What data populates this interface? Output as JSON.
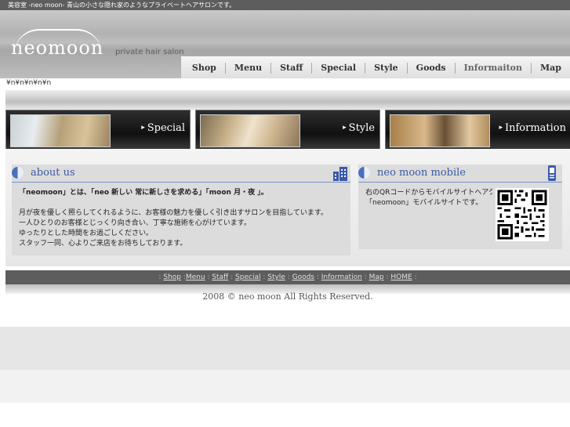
{
  "topbar": {
    "text": "美容室 -neo moon- 青山の小さな隠れ家のようなプライベートヘアサロンです。"
  },
  "header": {
    "logo": "neomoon",
    "tagline": "private hair salon",
    "nav": [
      "Shop",
      "Menu",
      "Staff",
      "Special",
      "Style",
      "Goods",
      "Informaiton",
      "Map"
    ]
  },
  "crumb": "¥n¥n¥n¥n¥n",
  "banners": [
    {
      "label": "Special"
    },
    {
      "label": "Style"
    },
    {
      "label": "Information"
    }
  ],
  "about": {
    "title": "about us",
    "lines": [
      "「neomoon」とは、「neo 新しい 常に新しさを求める」「moon 月・夜 」。",
      "月が夜を優しく照らしてくれるように、お客様の魅力を優しく引き出すサロンを目指しています。",
      "一人ひとりのお客様とじっくり向き合い、丁寧な施術を心がけています。",
      "ゆったりとした時間をお過ごしください。",
      "スタッフ一同、心よりご来店をお待ちしております。"
    ]
  },
  "mobile": {
    "title": "neo moon mobile",
    "lines": [
      "右のQRコードからモバイルサイトへアクセスできます。",
      "「neomoon」モバイルサイトです。"
    ]
  },
  "footer": {
    "links": [
      "Shop",
      "Menu",
      "Staff",
      "Special",
      "Style",
      "Goods",
      "Information",
      "Map",
      "HOME"
    ],
    "copyright": "2008 © neo moon All Rights Reserved."
  },
  "colors": {
    "accent": "#3a5aa8",
    "dark": "#5d5d5d"
  }
}
